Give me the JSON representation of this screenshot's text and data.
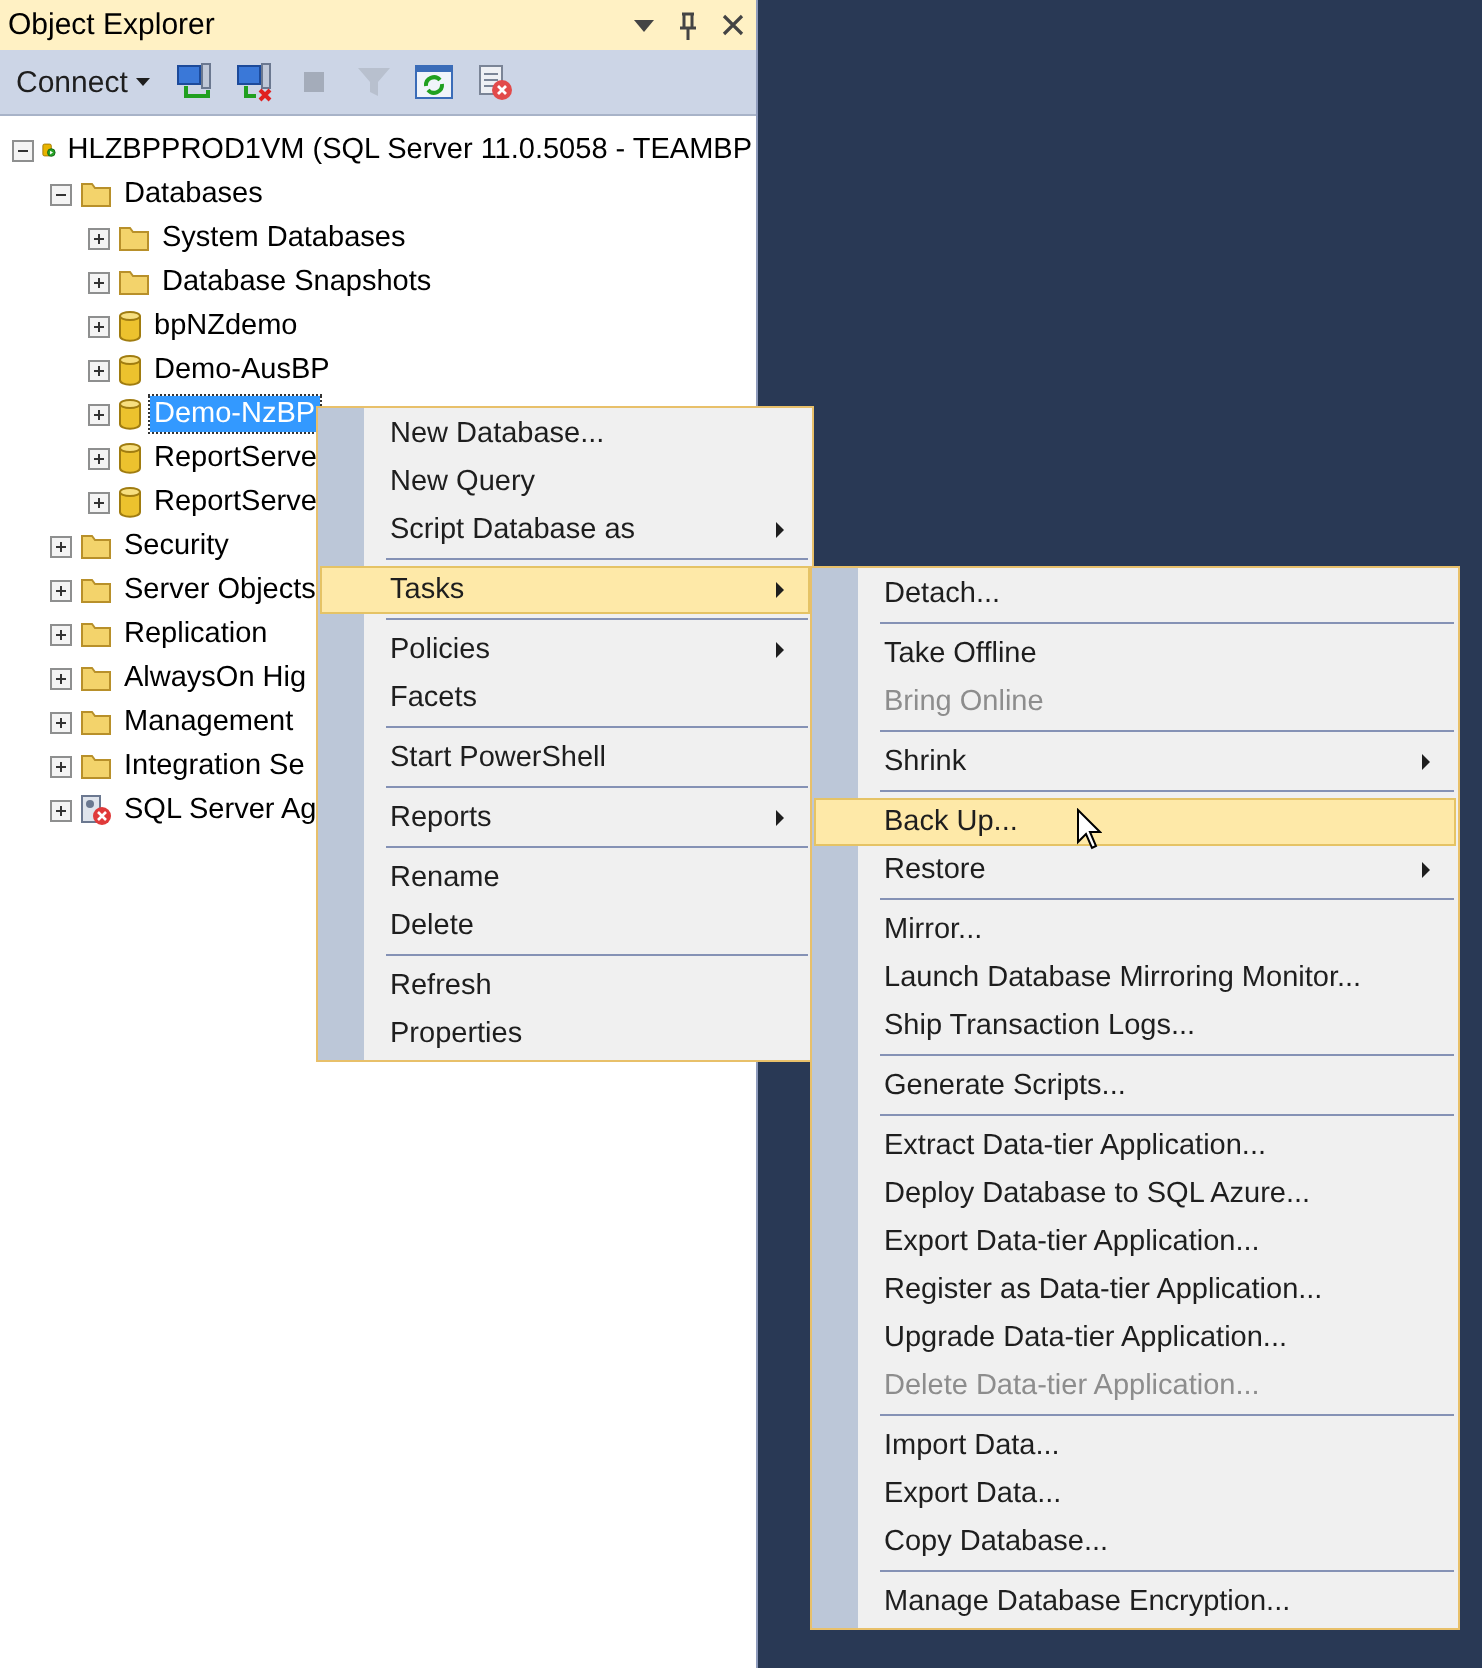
{
  "panel": {
    "title": "Object Explorer",
    "toolbar": {
      "connect_label": "Connect"
    }
  },
  "tree": [
    {
      "label": "HLZBPPROD1VM (SQL Server 11.0.5058 - TEAMBP",
      "kind": "server",
      "expanded": true,
      "selected": false,
      "children": [
        {
          "label": "Databases",
          "kind": "folder",
          "expanded": true,
          "selected": false,
          "children": [
            {
              "label": "System Databases",
              "kind": "folder",
              "expanded": false,
              "selected": false
            },
            {
              "label": "Database Snapshots",
              "kind": "folder",
              "expanded": false,
              "selected": false
            },
            {
              "label": "bpNZdemo",
              "kind": "database",
              "expanded": false,
              "selected": false
            },
            {
              "label": "Demo-AusBP",
              "kind": "database",
              "expanded": false,
              "selected": false
            },
            {
              "label": "Demo-NzBP",
              "kind": "database",
              "expanded": false,
              "selected": true
            },
            {
              "label": "ReportServe",
              "kind": "database",
              "expanded": false,
              "selected": false
            },
            {
              "label": "ReportServe",
              "kind": "database",
              "expanded": false,
              "selected": false
            }
          ]
        },
        {
          "label": "Security",
          "kind": "folder",
          "expanded": false,
          "selected": false
        },
        {
          "label": "Server Objects",
          "kind": "folder",
          "expanded": false,
          "selected": false
        },
        {
          "label": "Replication",
          "kind": "folder",
          "expanded": false,
          "selected": false
        },
        {
          "label": "AlwaysOn Hig",
          "kind": "folder",
          "expanded": false,
          "selected": false
        },
        {
          "label": "Management",
          "kind": "folder",
          "expanded": false,
          "selected": false
        },
        {
          "label": "Integration Se",
          "kind": "folder",
          "expanded": false,
          "selected": false
        },
        {
          "label": "SQL Server Ag",
          "kind": "agent",
          "expanded": false,
          "selected": false
        }
      ]
    }
  ],
  "context_menu": [
    {
      "kind": "item",
      "label": "New Database...",
      "submenu": false,
      "selected": false,
      "disabled": false
    },
    {
      "kind": "item",
      "label": "New Query",
      "submenu": false,
      "selected": false,
      "disabled": false
    },
    {
      "kind": "item",
      "label": "Script Database as",
      "submenu": true,
      "selected": false,
      "disabled": false
    },
    {
      "kind": "separator"
    },
    {
      "kind": "item",
      "label": "Tasks",
      "submenu": true,
      "selected": true,
      "disabled": false
    },
    {
      "kind": "separator"
    },
    {
      "kind": "item",
      "label": "Policies",
      "submenu": true,
      "selected": false,
      "disabled": false
    },
    {
      "kind": "item",
      "label": "Facets",
      "submenu": false,
      "selected": false,
      "disabled": false
    },
    {
      "kind": "separator"
    },
    {
      "kind": "item",
      "label": "Start PowerShell",
      "submenu": false,
      "selected": false,
      "disabled": false
    },
    {
      "kind": "separator"
    },
    {
      "kind": "item",
      "label": "Reports",
      "submenu": true,
      "selected": false,
      "disabled": false
    },
    {
      "kind": "separator"
    },
    {
      "kind": "item",
      "label": "Rename",
      "submenu": false,
      "selected": false,
      "disabled": false
    },
    {
      "kind": "item",
      "label": "Delete",
      "submenu": false,
      "selected": false,
      "disabled": false
    },
    {
      "kind": "separator"
    },
    {
      "kind": "item",
      "label": "Refresh",
      "submenu": false,
      "selected": false,
      "disabled": false
    },
    {
      "kind": "item",
      "label": "Properties",
      "submenu": false,
      "selected": false,
      "disabled": false
    }
  ],
  "tasks_submenu": [
    {
      "kind": "item",
      "label": "Detach...",
      "submenu": false,
      "selected": false,
      "disabled": false
    },
    {
      "kind": "separator"
    },
    {
      "kind": "item",
      "label": "Take Offline",
      "submenu": false,
      "selected": false,
      "disabled": false
    },
    {
      "kind": "item",
      "label": "Bring Online",
      "submenu": false,
      "selected": false,
      "disabled": true
    },
    {
      "kind": "separator"
    },
    {
      "kind": "item",
      "label": "Shrink",
      "submenu": true,
      "selected": false,
      "disabled": false
    },
    {
      "kind": "separator"
    },
    {
      "kind": "item",
      "label": "Back Up...",
      "submenu": false,
      "selected": true,
      "disabled": false
    },
    {
      "kind": "item",
      "label": "Restore",
      "submenu": true,
      "selected": false,
      "disabled": false
    },
    {
      "kind": "separator"
    },
    {
      "kind": "item",
      "label": "Mirror...",
      "submenu": false,
      "selected": false,
      "disabled": false
    },
    {
      "kind": "item",
      "label": "Launch Database Mirroring Monitor...",
      "submenu": false,
      "selected": false,
      "disabled": false
    },
    {
      "kind": "item",
      "label": "Ship Transaction Logs...",
      "submenu": false,
      "selected": false,
      "disabled": false
    },
    {
      "kind": "separator"
    },
    {
      "kind": "item",
      "label": "Generate Scripts...",
      "submenu": false,
      "selected": false,
      "disabled": false
    },
    {
      "kind": "separator"
    },
    {
      "kind": "item",
      "label": "Extract Data-tier Application...",
      "submenu": false,
      "selected": false,
      "disabled": false
    },
    {
      "kind": "item",
      "label": "Deploy Database to SQL Azure...",
      "submenu": false,
      "selected": false,
      "disabled": false
    },
    {
      "kind": "item",
      "label": "Export Data-tier Application...",
      "submenu": false,
      "selected": false,
      "disabled": false
    },
    {
      "kind": "item",
      "label": "Register as Data-tier Application...",
      "submenu": false,
      "selected": false,
      "disabled": false
    },
    {
      "kind": "item",
      "label": "Upgrade Data-tier Application...",
      "submenu": false,
      "selected": false,
      "disabled": false
    },
    {
      "kind": "item",
      "label": "Delete Data-tier Application...",
      "submenu": false,
      "selected": false,
      "disabled": true
    },
    {
      "kind": "separator"
    },
    {
      "kind": "item",
      "label": "Import Data...",
      "submenu": false,
      "selected": false,
      "disabled": false
    },
    {
      "kind": "item",
      "label": "Export Data...",
      "submenu": false,
      "selected": false,
      "disabled": false
    },
    {
      "kind": "item",
      "label": "Copy Database...",
      "submenu": false,
      "selected": false,
      "disabled": false
    },
    {
      "kind": "separator"
    },
    {
      "kind": "item",
      "label": "Manage Database Encryption...",
      "submenu": false,
      "selected": false,
      "disabled": false
    }
  ]
}
